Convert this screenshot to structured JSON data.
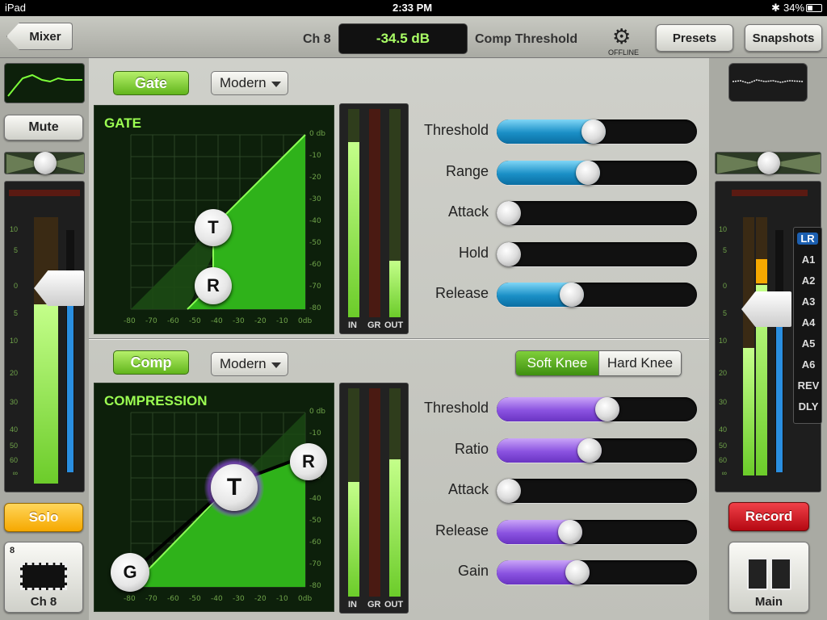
{
  "status": {
    "device": "iPad",
    "time": "2:33 PM",
    "battery": "34%"
  },
  "topbar": {
    "back_label": "Mixer",
    "channel": "Ch 8",
    "readout": "-34.5 dB",
    "param": "Comp Threshold",
    "settings_label": "OFFLINE",
    "presets_label": "Presets",
    "snapshots_label": "Snapshots"
  },
  "left": {
    "mute_label": "Mute",
    "solo_label": "Solo",
    "channel_number": "8",
    "channel_name": "Ch 8",
    "scale": [
      "10",
      "5",
      "0",
      "5",
      "10",
      "20",
      "30",
      "40",
      "50",
      "60",
      "∞"
    ]
  },
  "right": {
    "record_label": "Record",
    "main_label": "Main",
    "buses": [
      "LR",
      "A1",
      "A2",
      "A3",
      "A4",
      "A5",
      "A6",
      "REV",
      "DLY"
    ],
    "scale": [
      "10",
      "5",
      "0",
      "5",
      "10",
      "20",
      "30",
      "40",
      "50",
      "60",
      "∞"
    ]
  },
  "gate": {
    "enable_label": "Gate",
    "mode": "Modern",
    "graph_title": "GATE",
    "y_ticks": [
      "0 db",
      "-10",
      "-20",
      "-30",
      "-40",
      "-50",
      "-60",
      "-70",
      "-80"
    ],
    "x_ticks": [
      "-80",
      "-70",
      "-60",
      "-50",
      "-40",
      "-30",
      "-20",
      "-10",
      "0db"
    ],
    "threshold_point": "T",
    "range_point": "R",
    "meter_labels": [
      "IN",
      "GR",
      "OUT"
    ],
    "meter_levels": [
      0.84,
      0.0,
      0.27
    ],
    "params": [
      {
        "label": "Threshold",
        "value": 0.48
      },
      {
        "label": "Range",
        "value": 0.45
      },
      {
        "label": "Attack",
        "value": 0.0
      },
      {
        "label": "Hold",
        "value": 0.0
      },
      {
        "label": "Release",
        "value": 0.36
      }
    ]
  },
  "comp": {
    "enable_label": "Comp",
    "mode": "Modern",
    "graph_title": "COMPRESSION",
    "soft_knee_label": "Soft Knee",
    "hard_knee_label": "Hard Knee",
    "y_ticks": [
      "0 db",
      "-10",
      "-20",
      "-30",
      "-40",
      "-50",
      "-60",
      "-70",
      "-80"
    ],
    "x_ticks": [
      "-80",
      "-70",
      "-60",
      "-50",
      "-40",
      "-30",
      "-20",
      "-10",
      "0db"
    ],
    "threshold_point": "T",
    "ratio_point": "R",
    "gain_point": "G",
    "meter_labels": [
      "IN",
      "GR",
      "OUT"
    ],
    "meter_levels": [
      0.55,
      0.0,
      0.66
    ],
    "params": [
      {
        "label": "Threshold",
        "value": 0.56
      },
      {
        "label": "Ratio",
        "value": 0.46
      },
      {
        "label": "Attack",
        "value": 0.0
      },
      {
        "label": "Release",
        "value": 0.35
      },
      {
        "label": "Gain",
        "value": 0.39
      }
    ]
  },
  "colors": {
    "accent_green": "#6ccc2a",
    "gate_slider": "#1a8fc6",
    "comp_slider": "#8a52e0",
    "solo": "#f6a800",
    "record": "#c8101a"
  }
}
